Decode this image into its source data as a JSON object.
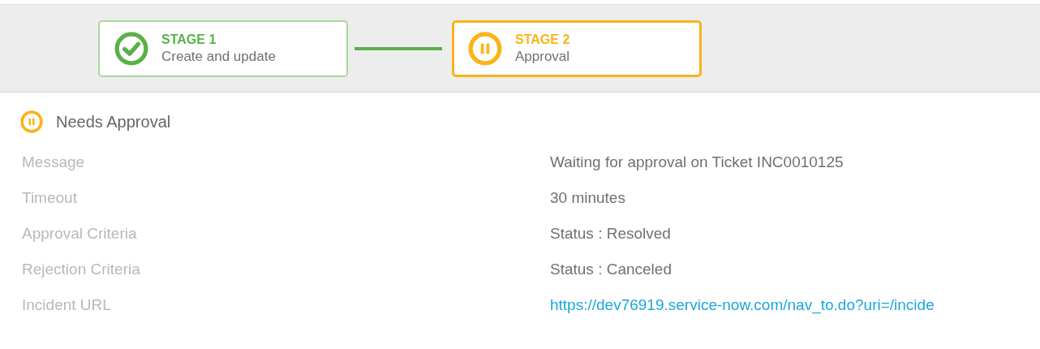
{
  "stages": [
    {
      "title": "STAGE 1",
      "subtitle": "Create and update",
      "kind": "complete",
      "selected": false
    },
    {
      "title": "STAGE 2",
      "subtitle": "Approval",
      "kind": "waiting",
      "selected": true
    }
  ],
  "current_status": {
    "kind": "waiting",
    "label": "Needs Approval"
  },
  "details": [
    {
      "label": "Message",
      "value": "Waiting for approval on Ticket INC0010125",
      "kind": "text"
    },
    {
      "label": "Timeout",
      "value": "30 minutes",
      "kind": "text"
    },
    {
      "label": "Approval Criteria",
      "value": "Status : Resolved",
      "kind": "text"
    },
    {
      "label": "Rejection Criteria",
      "value": "Status : Canceled",
      "kind": "text"
    },
    {
      "label": "Incident URL",
      "value": "https://dev76919.service-now.com/nav_to.do?uri=/incide",
      "kind": "link"
    }
  ]
}
